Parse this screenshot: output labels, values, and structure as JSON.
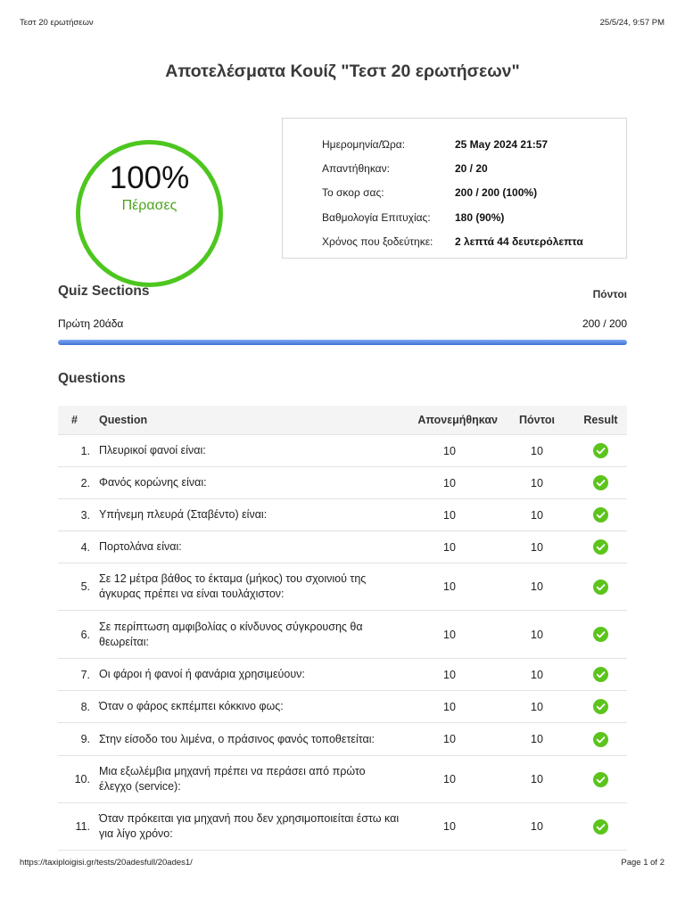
{
  "print_header": {
    "doc_title": "Τεστ 20 ερωτήσεων",
    "datetime": "25/5/24, 9:57 PM"
  },
  "print_footer": {
    "url": "https://taxiploigisi.gr/tests/20adesfull/20ades1/",
    "page": "Page 1 of 2"
  },
  "title": "Αποτελέσματα Κουίζ \"Τεστ 20 ερωτήσεων\"",
  "score": {
    "percent": "100%",
    "status": "Πέρασες",
    "ring_color": "#4dc71f"
  },
  "info": [
    {
      "label": "Ημερομηνία/Ώρα:",
      "value": "25 May 2024 21:57"
    },
    {
      "label": "Απαντήθηκαν:",
      "value": "20 / 20"
    },
    {
      "label": "Το σκορ σας:",
      "value": "200 / 200 (100%)"
    },
    {
      "label": "Βαθμολογία Επιτυχίας:",
      "value": "180 (90%)"
    },
    {
      "label": "Χρόνος που ξοδεύτηκε:",
      "value": "2 λεπτά 44 δευτερόλεπτα"
    }
  ],
  "sections": {
    "title": "Quiz Sections",
    "points_header": "Πόντοι",
    "items": [
      {
        "name": "Πρώτη 20άδα",
        "score": "200 / 200",
        "progress": 1.0
      }
    ]
  },
  "questions": {
    "title": "Questions",
    "headers": {
      "num": "#",
      "question": "Question",
      "awarded": "Απονεμήθηκαν",
      "points": "Πόντοι",
      "result": "Result"
    },
    "rows": [
      {
        "num": "1.",
        "text": "Πλευρικοί φανοί είναι:",
        "awarded": "10",
        "points": "10",
        "result": "correct"
      },
      {
        "num": "2.",
        "text": "Φανός κορώνης είναι:",
        "awarded": "10",
        "points": "10",
        "result": "correct"
      },
      {
        "num": "3.",
        "text": "Υπήνεμη πλευρά (Σταβέντο) είναι:",
        "awarded": "10",
        "points": "10",
        "result": "correct"
      },
      {
        "num": "4.",
        "text": "Πορτολάνα είναι:",
        "awarded": "10",
        "points": "10",
        "result": "correct"
      },
      {
        "num": "5.",
        "text": "Σε 12 μέτρα βάθος το έκταμα (μήκος) του σχοινιού της άγκυρας πρέπει να είναι τουλάχιστον:",
        "awarded": "10",
        "points": "10",
        "result": "correct"
      },
      {
        "num": "6.",
        "text": "Σε περίπτωση αμφιβολίας ο κίνδυνος σύγκρουσης θα θεωρείται:",
        "awarded": "10",
        "points": "10",
        "result": "correct"
      },
      {
        "num": "7.",
        "text": "Οι φάροι ή φανοί ή φανάρια χρησιμεύουν:",
        "awarded": "10",
        "points": "10",
        "result": "correct"
      },
      {
        "num": "8.",
        "text": "Όταν ο φάρος εκπέμπει κόκκινο φως:",
        "awarded": "10",
        "points": "10",
        "result": "correct"
      },
      {
        "num": "9.",
        "text": "Στην είσοδο του λιμένα, ο πράσινος φανός τοποθετείται:",
        "awarded": "10",
        "points": "10",
        "result": "correct"
      },
      {
        "num": "10.",
        "text": "Μια εξωλέμβια μηχανή πρέπει να περάσει από πρώτο έλεγχο (service):",
        "awarded": "10",
        "points": "10",
        "result": "correct"
      },
      {
        "num": "11.",
        "text": "Όταν πρόκειται για μηχανή που δεν χρησιμοποιείται έστω και για λίγο χρόνο:",
        "awarded": "10",
        "points": "10",
        "result": "correct"
      }
    ]
  },
  "colors": {
    "check": "#5cc41c",
    "progress": "#4a7ee0"
  }
}
